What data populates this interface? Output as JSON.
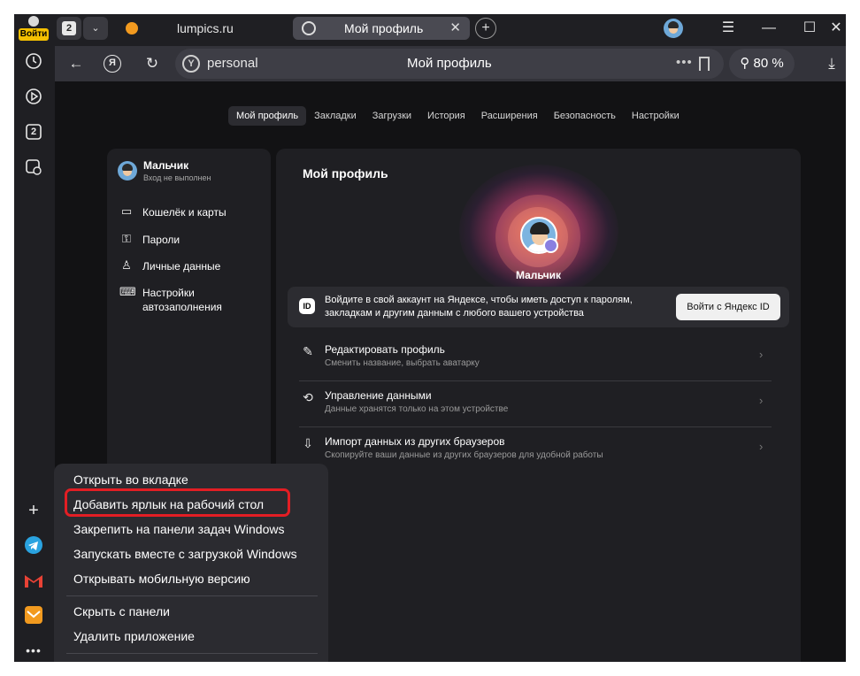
{
  "rail": {
    "login_label": "Войти",
    "tab_count": "2"
  },
  "tabs": {
    "count": "2",
    "items": [
      {
        "title": "lumpics.ru"
      },
      {
        "title": "Мой профиль"
      }
    ]
  },
  "navbar": {
    "url": "personal",
    "page_title": "Мой профиль",
    "zoom": "80 %"
  },
  "page": {
    "menu_tabs": [
      "Мой профиль",
      "Закладки",
      "Загрузки",
      "История",
      "Расширения",
      "Безопасность",
      "Настройки"
    ],
    "sidebar": {
      "user_name": "Мальчик",
      "user_status": "Вход не выполнен",
      "items": [
        {
          "label": "Кошелёк и карты"
        },
        {
          "label": "Пароли"
        },
        {
          "label": "Личные данные"
        },
        {
          "label": "Настройки автозаполнения"
        }
      ]
    },
    "profile": {
      "title": "Мой профиль",
      "name": "Мальчик",
      "signin_text": "Войдите в свой аккаунт на Яндексе, чтобы иметь доступ к паролям, закладкам и другим данным с любого вашего устройства",
      "signin_button": "Войти с Яндекс ID",
      "rows": [
        {
          "title": "Редактировать профиль",
          "subtitle": "Сменить название, выбрать аватарку"
        },
        {
          "title": "Управление данными",
          "subtitle": "Данные хранятся только на этом устройстве"
        },
        {
          "title": "Импорт данных из других браузеров",
          "subtitle": "Скопируйте ваши данные из других браузеров для удобной работы"
        }
      ]
    }
  },
  "context_menu": {
    "items": [
      "Открыть во вкладке",
      "Добавить ярлык на рабочий стол",
      "Закрепить на панели задач Windows",
      "Запускать вместе с загрузкой Windows",
      "Открывать мобильную версию",
      "Скрыть с панели",
      "Удалить приложение"
    ]
  },
  "colors": {
    "highlight": "#e31e24",
    "accent_login": "#f5c000"
  }
}
